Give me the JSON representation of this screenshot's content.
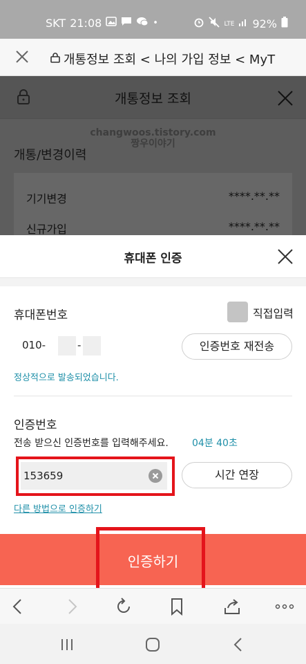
{
  "status_bar": {
    "carrier": "SKT",
    "time": "21:08",
    "network": "LTE",
    "battery": "92%"
  },
  "browser": {
    "page_title": "개통정보 조회 < 나의 가입 정보 < MyT"
  },
  "background_page": {
    "title": "개통정보 조회",
    "watermark_line1": "changwoos.tistory.com",
    "watermark_line2": "짱우이야기",
    "section_title": "개통/변경이력",
    "rows": [
      {
        "label": "기기변경",
        "value": "****.**.**"
      },
      {
        "label": "신규가입",
        "value": "****.**.**"
      }
    ]
  },
  "sheet": {
    "title": "휴대폰 인증",
    "phone_label": "휴대폰번호",
    "direct_input_label": "직접입력",
    "phone_prefix": "010-",
    "phone_dash": "-",
    "resend_button": "인증번호 재전송",
    "sent_message": "정상적으로 발송되었습니다.",
    "code_label": "인증번호",
    "code_hint": "전송 받으신 인증번호를 입력해주세요.",
    "timer": "04분 40초",
    "code_value": "153659",
    "extend_button": "시간 연장",
    "alt_link": "다른 방법으로 인증하기",
    "submit_button": "인증하기"
  },
  "colors": {
    "accent": "#f76452",
    "link": "#1e8fa8",
    "highlight": "#e4141b"
  }
}
